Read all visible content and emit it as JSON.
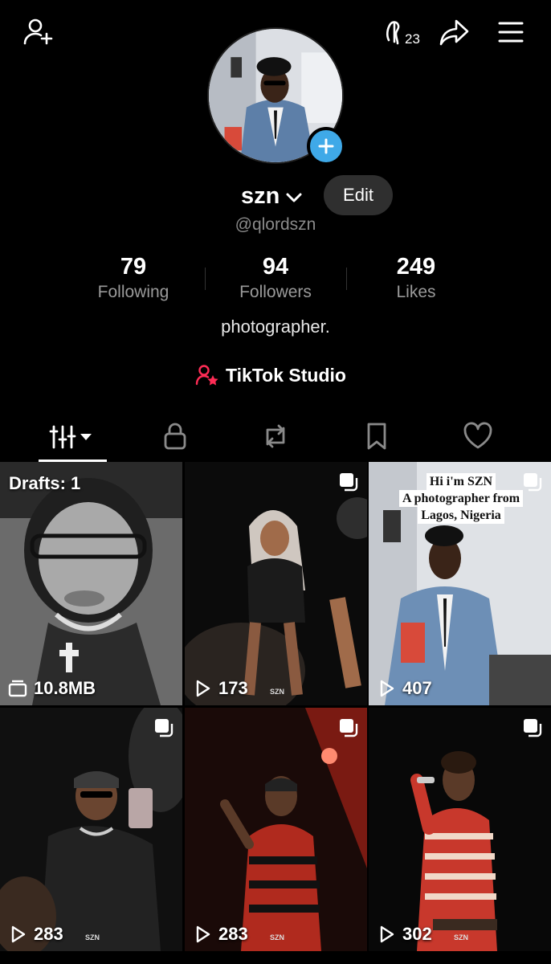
{
  "profile": {
    "display_name": "szn",
    "handle": "@qlordszn",
    "edit_label": "Edit",
    "bio": "photographer.",
    "studio_label": "TikTok Studio",
    "views_badge": "23"
  },
  "stats": [
    {
      "value": "79",
      "label": "Following"
    },
    {
      "value": "94",
      "label": "Followers"
    },
    {
      "value": "249",
      "label": "Likes"
    }
  ],
  "tabs": [
    {
      "name": "videos",
      "icon": "grid-icon",
      "active": true
    },
    {
      "name": "private",
      "icon": "lock-icon"
    },
    {
      "name": "reposts",
      "icon": "repost-icon"
    },
    {
      "name": "favorites",
      "icon": "bookmark-icon"
    },
    {
      "name": "liked",
      "icon": "heart-icon"
    }
  ],
  "grid": {
    "drafts_label": "Drafts: 1",
    "drafts_size": "10.8MB",
    "items": [
      {
        "views": "173",
        "watermark": "SZN"
      },
      {
        "views": "407",
        "overlay": [
          "Hi i'm SZN",
          "A photographer from",
          "Lagos, Nigeria"
        ]
      },
      {
        "views": "283",
        "watermark": "SZN"
      },
      {
        "views": "283",
        "watermark": "SZN"
      },
      {
        "views": "302",
        "watermark": "SZN"
      }
    ]
  },
  "colors": {
    "accent_blue": "#3fa9e8",
    "studio_red": "#fe2c55",
    "background": "#000000"
  }
}
